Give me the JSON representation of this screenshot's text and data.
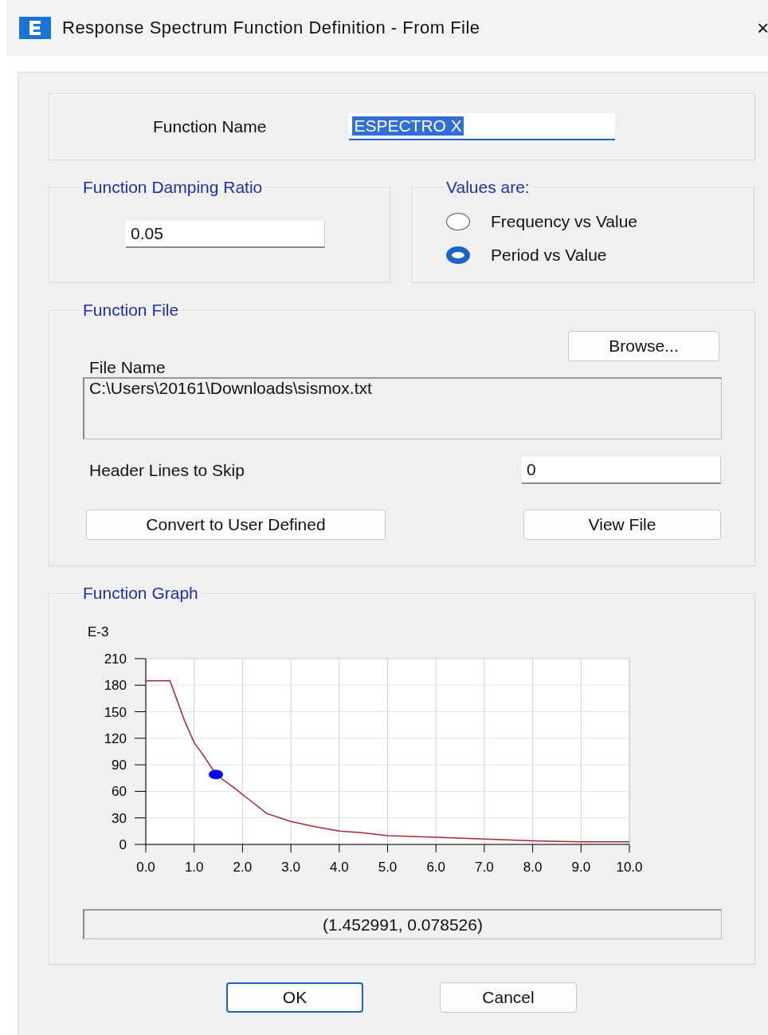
{
  "window": {
    "title": "Response Spectrum Function Definition - From File",
    "close": "×"
  },
  "function_name": {
    "label": "Function Name",
    "value": "ESPECTRO X",
    "highlighted": true
  },
  "damping": {
    "legend": "Function Damping Ratio",
    "value": "0.05"
  },
  "values_are": {
    "legend": "Values are:",
    "options": [
      {
        "label": "Frequency vs Value",
        "selected": false
      },
      {
        "label": "Period vs Value",
        "selected": true
      }
    ]
  },
  "function_file": {
    "legend": "Function File",
    "browse": "Browse...",
    "file_name_label": "File Name",
    "file_name": "C:\\Users\\20161\\Downloads\\sismox.txt",
    "header_label": "Header Lines to Skip",
    "header_value": "0",
    "convert_button": "Convert to User Defined",
    "view_button": "View File"
  },
  "function_graph": {
    "legend": "Function Graph",
    "readout": "(1.452991, 0.078526)",
    "chart_data": {
      "type": "line",
      "ylabel": "E-3",
      "grid": true,
      "xlim": [
        0,
        10
      ],
      "ylim": [
        0,
        210
      ],
      "xticks": [
        {
          "value": 0,
          "label": "0.0"
        },
        {
          "value": 1,
          "label": "1.0"
        },
        {
          "value": 2,
          "label": "2.0"
        },
        {
          "value": 3,
          "label": "3.0"
        },
        {
          "value": 4,
          "label": "4.0"
        },
        {
          "value": 5,
          "label": "5.0"
        },
        {
          "value": 6,
          "label": "6.0"
        },
        {
          "value": 7,
          "label": "7.0"
        },
        {
          "value": 8,
          "label": "8.0"
        },
        {
          "value": 9,
          "label": "9.0"
        },
        {
          "value": 10,
          "label": "10.0"
        }
      ],
      "yticks": [
        0,
        30,
        60,
        90,
        120,
        150,
        180,
        210
      ],
      "x": [
        0,
        0.5,
        0.6,
        0.8,
        1.0,
        1.2,
        1.45,
        1.8,
        2.2,
        2.5,
        3,
        3.5,
        4,
        4.5,
        5,
        6,
        7,
        8,
        9,
        10
      ],
      "series": [
        {
          "color": "#a52a2a",
          "values": [
            185,
            185,
            170,
            140,
            115,
            100,
            79,
            65,
            48,
            35,
            26,
            20,
            15,
            13,
            10,
            8,
            6,
            4,
            3,
            3
          ]
        }
      ]
    }
  },
  "buttons": [
    {
      "label": "OK",
      "default": true
    },
    {
      "label": "Cancel",
      "default": false
    }
  ]
}
